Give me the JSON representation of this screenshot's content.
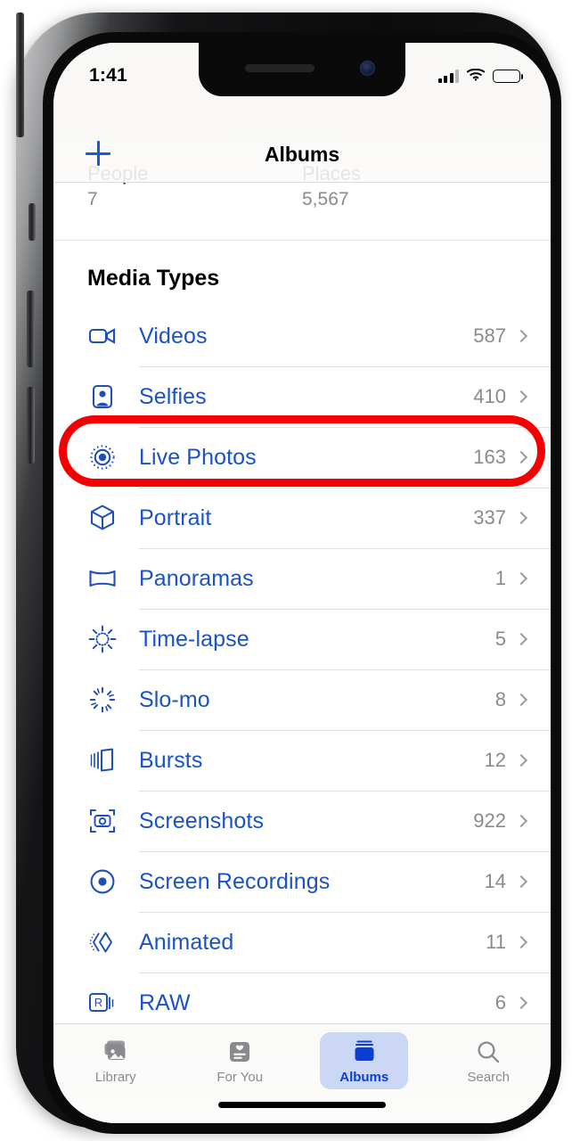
{
  "status_bar": {
    "time": "1:41",
    "signal_icon": "cellular-bars-icon",
    "wifi_icon": "wifi-icon",
    "battery_icon": "battery-full-icon"
  },
  "nav_bar": {
    "title": "Albums",
    "add_button_icon": "plus-icon",
    "add_button_label": "+"
  },
  "partial_section": {
    "cells": [
      {
        "title": "People",
        "count": "7"
      },
      {
        "title": "Places",
        "count": "5,567"
      }
    ]
  },
  "media_types": {
    "header": "Media Types",
    "rows": [
      {
        "label": "Videos",
        "count": "587",
        "icon": "video-camera-icon"
      },
      {
        "label": "Selfies",
        "count": "410",
        "icon": "selfie-person-icon"
      },
      {
        "label": "Live Photos",
        "count": "163",
        "icon": "live-photo-icon"
      },
      {
        "label": "Portrait",
        "count": "337",
        "icon": "cube-icon"
      },
      {
        "label": "Panoramas",
        "count": "1",
        "icon": "panorama-icon"
      },
      {
        "label": "Time-lapse",
        "count": "5",
        "icon": "timelapse-icon"
      },
      {
        "label": "Slo-mo",
        "count": "8",
        "icon": "slomo-icon"
      },
      {
        "label": "Bursts",
        "count": "12",
        "icon": "bursts-stack-icon"
      },
      {
        "label": "Screenshots",
        "count": "922",
        "icon": "screenshot-camera-icon"
      },
      {
        "label": "Screen Recordings",
        "count": "14",
        "icon": "record-dot-icon"
      },
      {
        "label": "Animated",
        "count": "11",
        "icon": "animated-chevrons-icon"
      },
      {
        "label": "RAW",
        "count": "6",
        "icon": "raw-badge-icon"
      }
    ]
  },
  "annotation": {
    "type": "red-rounded-rectangle-highlight",
    "target_row_label": "Live Photos",
    "color": "#f40000"
  },
  "tab_bar": {
    "items": [
      {
        "label": "Library",
        "icon": "photo-stack-icon",
        "active": false
      },
      {
        "label": "For You",
        "icon": "for-you-card-icon",
        "active": false
      },
      {
        "label": "Albums",
        "icon": "albums-book-icon",
        "active": true
      },
      {
        "label": "Search",
        "icon": "search-icon",
        "active": false
      }
    ]
  },
  "theme": {
    "link_blue": "#1b52c4",
    "icon_blue": "#1f4fb8",
    "secondary_gray": "#8a8a8e",
    "active_tab_blue": "#0b3fd4",
    "active_tab_pill": "#ccd6f5"
  }
}
